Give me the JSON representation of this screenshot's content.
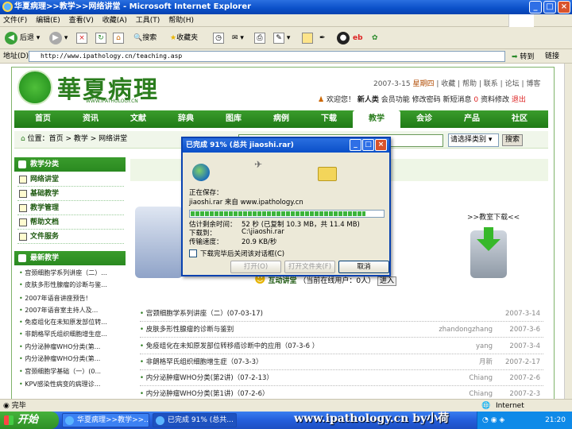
{
  "window": {
    "title": "华夏病理>>教学>>网络讲堂 - Microsoft Internet Explorer",
    "min": "_",
    "max": "□",
    "close": "×"
  },
  "menu": [
    "文件(F)",
    "编辑(E)",
    "查看(V)",
    "收藏(A)",
    "工具(T)",
    "帮助(H)"
  ],
  "toolbar": {
    "back": "后退",
    "search": "搜索",
    "favorites": "收藏夹"
  },
  "address": {
    "label": "地址(D)",
    "url": "http://www.ipathology.cn/teaching.asp",
    "go": "转到",
    "links": "链接"
  },
  "site": {
    "logo_text": "華夏病理",
    "logo_sub": "WWW.IPATHOLOGY.CN",
    "date": "2007-3-15",
    "weekday": "星期四",
    "top_links": [
      "收藏",
      "帮助",
      "联系",
      "论坛",
      "博客"
    ],
    "user_links": [
      "欢迎您！",
      "新人类",
      "会员功能",
      "修改密码",
      "新短消息",
      "0",
      "资料修改",
      "退出"
    ],
    "nav": [
      "首页",
      "资讯",
      "文献",
      "辞典",
      "图库",
      "病例",
      "下载",
      "教学",
      "会诊",
      "产品",
      "社区"
    ],
    "nav_active": "教学",
    "breadcrumb": "位置：首页 > 教学 > 网络讲堂",
    "search_select": "请选择类别",
    "search_button": "搜索"
  },
  "sidebar": {
    "category_title": "教学分类",
    "categories": [
      "网络讲堂",
      "基础教学",
      "教学管理",
      "帮助文档",
      "文件服务"
    ],
    "latest_title": "最新教学",
    "latest": [
      "宫颈细胞学系列讲座（二）...",
      "皮肤多形性腺瘤的诊断与鉴...",
      "2007年语音讲座预告!",
      "2007年语音室主持人及...",
      "免疫组化在未知原发部位转...",
      "非朗格罕氏组织细胞增生症...",
      "内分泌肿瘤WHO分类(第...",
      "内分泌肿瘤WHO分类(第...",
      "宫颈细胞学基础（一）(0...",
      "KPV感染性病变的病理诊..."
    ]
  },
  "main": {
    "download_title": ">>教室下载<<",
    "hudong_label": "互动讲堂",
    "hudong_online": "（当前在线用户：0人）",
    "enter": "进入",
    "list": [
      {
        "title": "宫颈细胞学系列讲座（二）(07-03-17)",
        "author": "",
        "date": "2007-3-14"
      },
      {
        "title": "皮肤多形性腺瘤的诊断与鉴别",
        "author": "zhandongzhang",
        "date": "2007-3-6"
      },
      {
        "title": "免疫组化在未知原发部位转移癌诊断中的应用（07-3-6 ）",
        "author": "yang",
        "date": "2007-3-4"
      },
      {
        "title": "非朗格罕氏组织细胞增生症（07-3-3）",
        "author": "月新",
        "date": "2007-2-17"
      },
      {
        "title": "内分泌肿瘤WHO分类(第2讲)（07-2-13）",
        "author": "Chiang",
        "date": "2007-2-6"
      },
      {
        "title": "内分泌肿瘤WHO分类(第1讲)（07-2-6）",
        "author": "Chiang",
        "date": "2007-2-3"
      }
    ]
  },
  "dialog": {
    "title": "已完成 91% (总共 jiaoshi.rar)",
    "saving": "正在保存：",
    "file_from": "jiaoshi.rar 来自 www.ipathology.cn",
    "progress": 0.91,
    "remaining_label": "估计剩余时间：",
    "remaining_value": "52 秒 (已复制 10.3 MB，共 11.4 MB)",
    "download_to_label": "下载到：",
    "download_to_value": "C:\\jiaoshi.rar",
    "rate_label": "传输速度：",
    "rate_value": "20.9 KB/秒",
    "checkbox": "下载完毕后关闭该对话框(C)",
    "open": "打开(O)",
    "open_folder": "打开文件夹(F)",
    "cancel": "取消"
  },
  "status": {
    "left": "完毕",
    "zone": "Internet"
  },
  "taskbar": {
    "start": "开始",
    "tasks": [
      "华夏病理>>教学>>...",
      "已完成 91% (总共..."
    ],
    "watermark": "www.ipathology.cn by小荷",
    "clock": "21:20"
  }
}
